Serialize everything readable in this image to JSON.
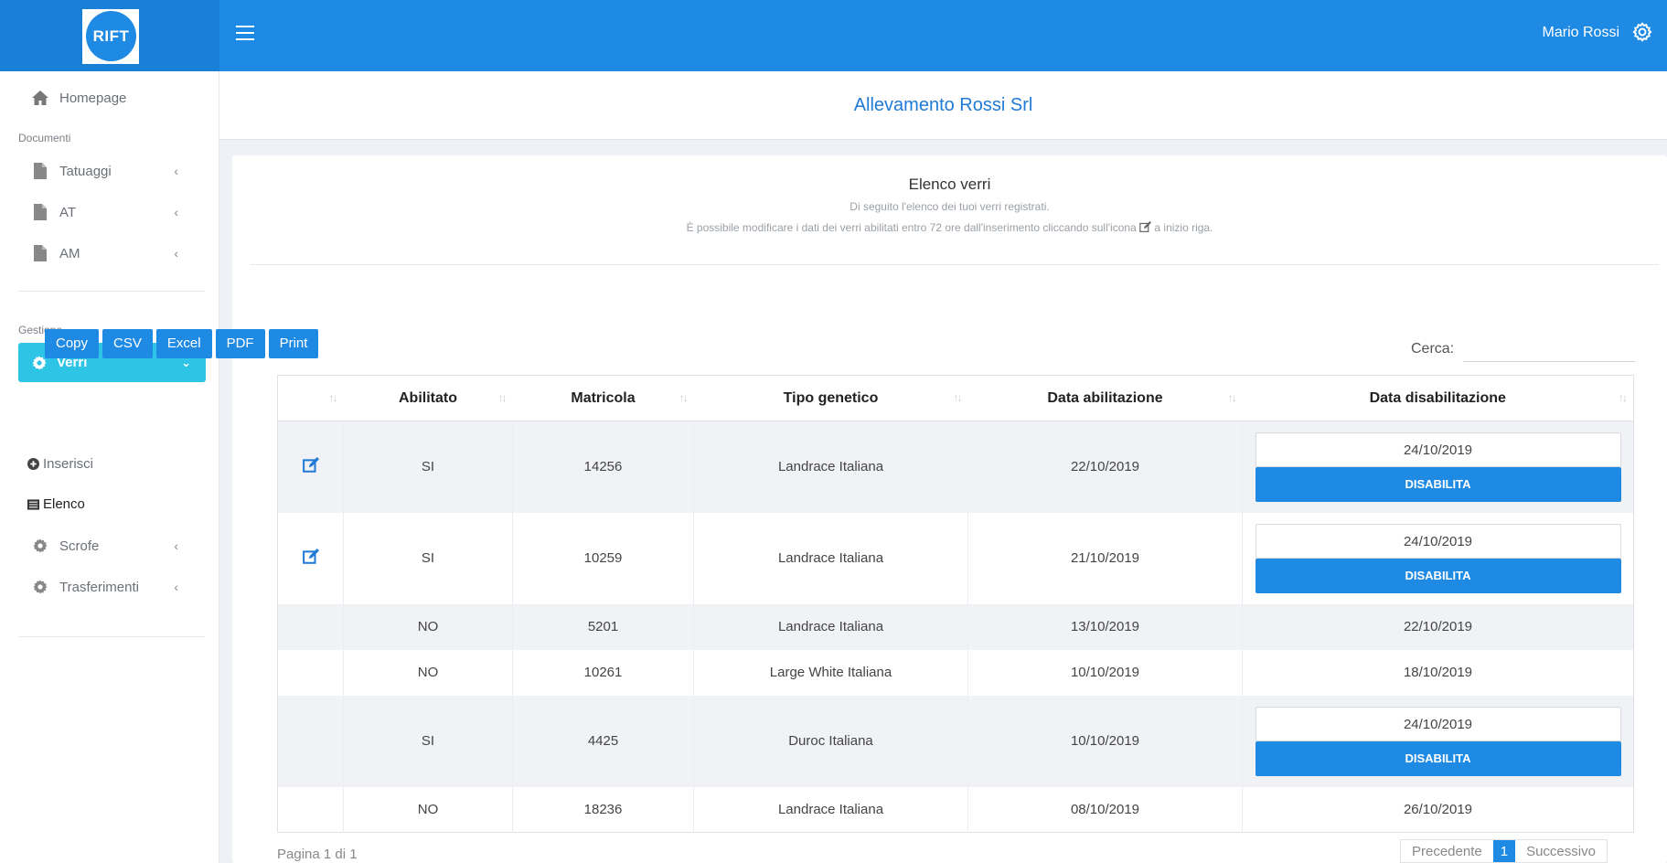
{
  "header": {
    "logo_text": "RIFT",
    "user_name": "Mario Rossi"
  },
  "sidebar": {
    "home_label": "Homepage",
    "section_documents": "Documenti",
    "doc_items": [
      {
        "label": "Tatuaggi"
      },
      {
        "label": "AT"
      },
      {
        "label": "AM"
      }
    ],
    "section_management": "Gestione",
    "active_item": "Verri",
    "sub_items": [
      {
        "label": "Inserisci"
      },
      {
        "label": "Elenco"
      }
    ],
    "other_items": [
      {
        "label": "Scrofe"
      },
      {
        "label": "Trasferimenti"
      }
    ]
  },
  "company": {
    "name": "Allevamento Rossi Srl"
  },
  "card": {
    "title": "Elenco verri",
    "subtitle": "Di seguito l'elenco dei tuoi verri registrati.",
    "note_before": "È possibile modificare i dati dei verri abilitati entro 72 ore dall'inserimento cliccando sull'icona ",
    "note_after": " a inizio riga."
  },
  "toolbar": {
    "buttons": [
      "Copy",
      "CSV",
      "Excel",
      "PDF",
      "Print"
    ],
    "search_label": "Cerca:",
    "search_value": ""
  },
  "table": {
    "columns": [
      "",
      "Abilitato",
      "Matricola",
      "Tipo genetico",
      "Data abilitazione",
      "Data disabilitazione"
    ],
    "rows": [
      {
        "editable": true,
        "abilitato": "SI",
        "matricola": "14256",
        "tipo": "Landrace Italiana",
        "data_abil": "22/10/2019",
        "data_disab": "24/10/2019",
        "action": "DISABILITA"
      },
      {
        "editable": true,
        "abilitato": "SI",
        "matricola": "10259",
        "tipo": "Landrace Italiana",
        "data_abil": "21/10/2019",
        "data_disab": "24/10/2019",
        "action": "DISABILITA"
      },
      {
        "editable": false,
        "abilitato": "NO",
        "matricola": "5201",
        "tipo": "Landrace Italiana",
        "data_abil": "13/10/2019",
        "data_disab": "22/10/2019",
        "action": ""
      },
      {
        "editable": false,
        "abilitato": "NO",
        "matricola": "10261",
        "tipo": "Large White Italiana",
        "data_abil": "10/10/2019",
        "data_disab": "18/10/2019",
        "action": ""
      },
      {
        "editable": false,
        "abilitato": "SI",
        "matricola": "4425",
        "tipo": "Duroc Italiana",
        "data_abil": "10/10/2019",
        "data_disab": "24/10/2019",
        "action": "DISABILITA"
      },
      {
        "editable": false,
        "abilitato": "NO",
        "matricola": "18236",
        "tipo": "Landrace Italiana",
        "data_abil": "08/10/2019",
        "data_disab": "26/10/2019",
        "action": ""
      }
    ]
  },
  "pagination": {
    "info": "Pagina 1 di 1",
    "prev": "Precedente",
    "current": "1",
    "next": "Successivo"
  },
  "colors": {
    "primary": "#1f8ae3",
    "active_nav": "#2ec4e6",
    "company_title": "#1f7ad6"
  }
}
